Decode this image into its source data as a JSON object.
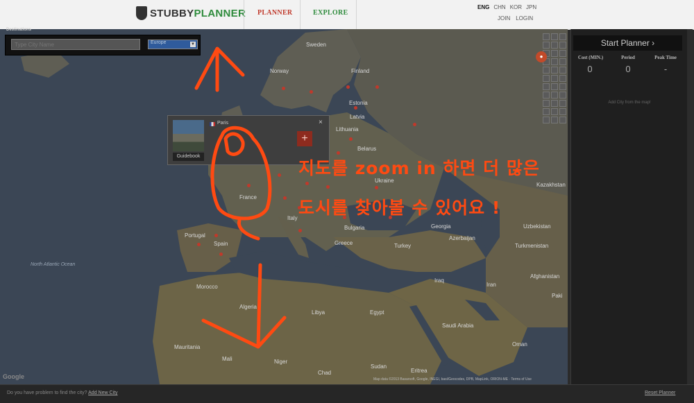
{
  "header": {
    "logo_part1": "STUBBY",
    "logo_part2": "PLANNER",
    "nav_planner": "PLANNER",
    "nav_explore": "EXPLORE",
    "languages": [
      "ENG",
      "CHN",
      "KOR",
      "JPN"
    ],
    "join": "JOIN",
    "login": "LOGIN"
  },
  "search": {
    "label": "Destinations",
    "placeholder": "Type City Name",
    "region": "Europe"
  },
  "popup": {
    "city": "Paris",
    "guidebook": "Guidebook",
    "add": "+",
    "close": "×"
  },
  "map_labels": {
    "countries": [
      "Sweden",
      "Norway",
      "Finland",
      "Estonia",
      "Latvia",
      "Lithuania",
      "Belarus",
      "Ukraine",
      "Kazakhstan",
      "France",
      "Portugal",
      "Spain",
      "Italy",
      "Greece",
      "Bulgaria",
      "Georgia",
      "Turkey",
      "Azerbaijan",
      "Uzbekistan",
      "Turkmenistan",
      "Morocco",
      "Algeria",
      "Libya",
      "Egypt",
      "Iraq",
      "Iran",
      "Afghanistan",
      "Saudi Arabia",
      "Mauritania",
      "Mali",
      "Niger",
      "Chad",
      "Sudan",
      "Eritrea",
      "Oman",
      "Paki"
    ],
    "ocean": "North Atlantic Ocean",
    "google": "Google"
  },
  "attribution": "Map data ©2013 Basarsoft, Google, INEGI, basi/Geocodes, DPB, MapLink, ORION-ME · Terms of Use",
  "sidebar": {
    "start_button": "Start Planner ›",
    "cost_label": "Cost (MIN.)",
    "period_label": "Period",
    "peak_label": "Peak Time",
    "cost_value": "0",
    "period_value": "0",
    "peak_value": "-",
    "hint": "Add City from the map!"
  },
  "footer": {
    "text": "Do you have problem to find the city?",
    "link": "Add New City",
    "reset": "Reset Planner"
  },
  "annotation": {
    "line1": "지도를 zoom in 하면 더 많은",
    "line2": "도시를 찾아볼 수 있어요 !",
    "color": "#ff4a12"
  }
}
